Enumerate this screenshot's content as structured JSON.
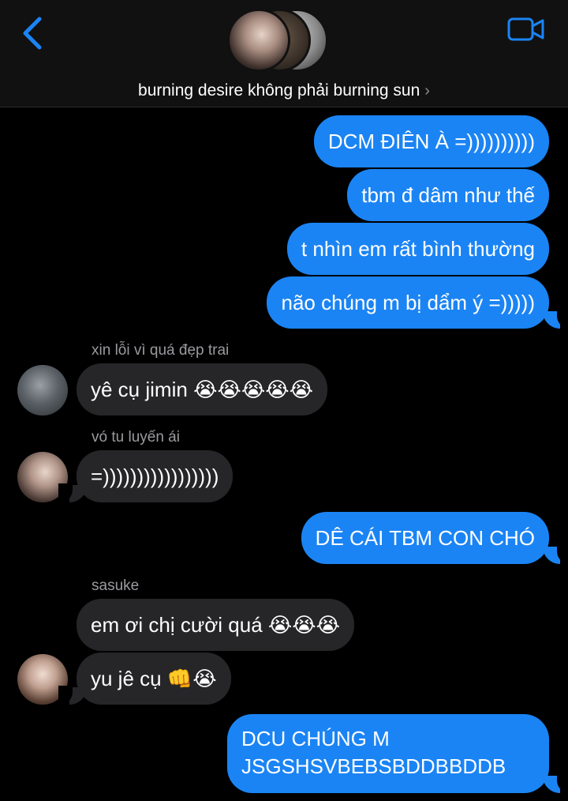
{
  "header": {
    "title": "burning desire không phải burning sun",
    "title_chevron": "›",
    "back_icon": "chevron-left-icon",
    "video_icon": "video-camera-icon",
    "accent_color": "#1b84f4"
  },
  "messages": [
    {
      "direction": "outgoing",
      "text": "DCM ĐIÊN À =))))))))))"
    },
    {
      "direction": "outgoing",
      "text": "tbm đ dâm như thế"
    },
    {
      "direction": "outgoing",
      "text": "t nhìn em rất bình thường"
    },
    {
      "direction": "outgoing",
      "text": "não chúng m bị dẩm ý =)))))"
    },
    {
      "direction": "incoming",
      "sender": "xin lỗi vì quá đẹp trai",
      "text": "yê cụ jimin",
      "emojis": "😭😭😭😭😭"
    },
    {
      "direction": "incoming",
      "sender": "vó tu luyến ái",
      "text": "=)))))))))))))))))"
    },
    {
      "direction": "outgoing",
      "text": "DÊ CÁI TBM CON CHÓ"
    },
    {
      "direction": "incoming",
      "sender": "sasuke",
      "text": "em ơi chị cười quá",
      "emojis": "😭😭😭"
    },
    {
      "direction": "incoming",
      "text": "yu jê cụ",
      "emojis": "👊😭"
    },
    {
      "direction": "outgoing",
      "text": "DCU CHÚNG M JSGSHSVBEBSBDDBBDDB"
    }
  ],
  "colors": {
    "outgoing_bubble": "#1b84f4",
    "incoming_bubble": "#262628",
    "background": "#000000",
    "sender_name": "#9a9a9f"
  }
}
